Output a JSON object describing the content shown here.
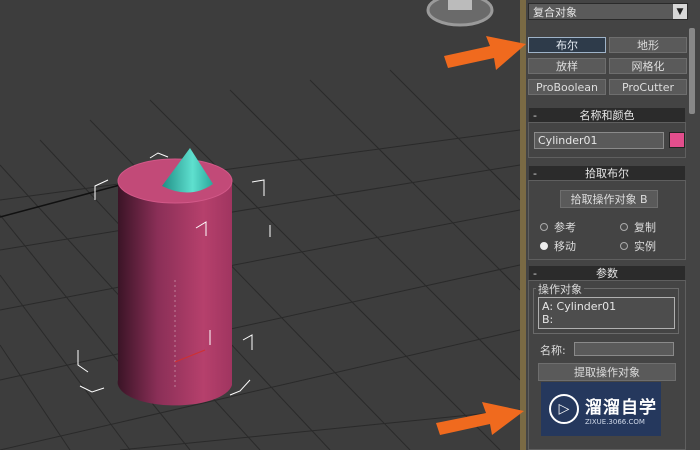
{
  "panel": {
    "category_dropdown": "复合对象",
    "object_types": {
      "boolean": "布尔",
      "terrain": "地形",
      "loft": "放样",
      "mesher": "网格化",
      "proboolean": "ProBoolean",
      "procutter": "ProCutter"
    },
    "name_color": {
      "title": "名称和颜色",
      "object_name": "Cylinder01",
      "color": "#e24e8c"
    },
    "pick_boolean": {
      "title": "拾取布尔",
      "pick_button": "拾取操作对象 B",
      "options": [
        {
          "label": "参考",
          "selected": false
        },
        {
          "label": "复制",
          "selected": false
        },
        {
          "label": "移动",
          "selected": true
        },
        {
          "label": "实例",
          "selected": false
        }
      ]
    },
    "parameters": {
      "title": "参数",
      "operands_label": "操作对象",
      "operand_a": "A: Cylinder01",
      "operand_b": "B:",
      "name_label": "名称:",
      "name_value": "",
      "extract_button": "提取操作对象"
    }
  },
  "watermark": {
    "title": "溜溜自学",
    "sub": "ZIXUE.3066.COM"
  },
  "colors": {
    "arrow": "#f06a1e",
    "cylinder": "#b8406c",
    "cone": "#3cc0b0"
  }
}
